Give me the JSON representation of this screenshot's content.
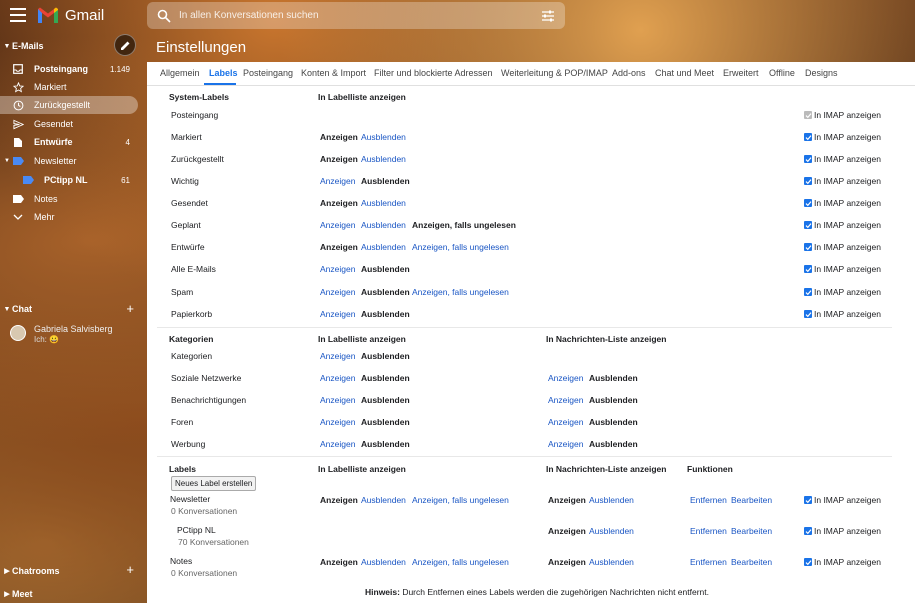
{
  "app": {
    "name": "Gmail"
  },
  "search": {
    "placeholder": "In allen Konversationen suchen"
  },
  "sidebar": {
    "section_mails": "E-Mails",
    "items": [
      {
        "label": "Posteingang",
        "count": "1.149"
      },
      {
        "label": "Markiert",
        "count": ""
      },
      {
        "label": "Zurückgestellt",
        "count": ""
      },
      {
        "label": "Gesendet",
        "count": ""
      },
      {
        "label": "Entwürfe",
        "count": "4"
      },
      {
        "label": "Newsletter",
        "count": ""
      },
      {
        "label": "PCtipp NL",
        "count": "61"
      },
      {
        "label": "Notes",
        "count": ""
      },
      {
        "label": "Mehr",
        "count": ""
      }
    ],
    "section_chat": "Chat",
    "chat_user": {
      "name": "Gabriela Salvisberg",
      "status": "Ich: 😀"
    },
    "section_chatrooms": "Chatrooms",
    "section_meet": "Meet"
  },
  "page_title": "Einstellungen",
  "tabs": [
    "Allgemein",
    "Labels",
    "Posteingang",
    "Konten & Import",
    "Filter und blockierte Adressen",
    "Weiterleitung & POP/IMAP",
    "Add-ons",
    "Chat und Meet",
    "Erweitert",
    "Offline",
    "Designs"
  ],
  "system": {
    "header": "System-Labels",
    "col_list": "In Labelliste anzeigen",
    "rows": [
      {
        "name": "Posteingang",
        "opts": [],
        "imap": "In IMAP anzeigen"
      },
      {
        "name": "Markiert",
        "opts": [
          [
            "Anzeigen",
            true
          ],
          [
            "Ausblenden",
            false
          ]
        ],
        "imap": "In IMAP anzeigen"
      },
      {
        "name": "Zurückgestellt",
        "opts": [
          [
            "Anzeigen",
            true
          ],
          [
            "Ausblenden",
            false
          ]
        ],
        "imap": "In IMAP anzeigen"
      },
      {
        "name": "Wichtig",
        "opts": [
          [
            "Anzeigen",
            false
          ],
          [
            "Ausblenden",
            true
          ]
        ],
        "imap": "In IMAP anzeigen"
      },
      {
        "name": "Gesendet",
        "opts": [
          [
            "Anzeigen",
            true
          ],
          [
            "Ausblenden",
            false
          ]
        ],
        "imap": "In IMAP anzeigen"
      },
      {
        "name": "Geplant",
        "opts": [
          [
            "Anzeigen",
            false
          ],
          [
            "Ausblenden",
            false
          ],
          [
            "Anzeigen, falls ungelesen",
            true
          ]
        ],
        "imap": "In IMAP anzeigen"
      },
      {
        "name": "Entwürfe",
        "opts": [
          [
            "Anzeigen",
            true
          ],
          [
            "Ausblenden",
            false
          ],
          [
            "Anzeigen, falls ungelesen",
            false
          ]
        ],
        "imap": "In IMAP anzeigen"
      },
      {
        "name": "Alle E-Mails",
        "opts": [
          [
            "Anzeigen",
            false
          ],
          [
            "Ausblenden",
            true
          ]
        ],
        "imap": "In IMAP anzeigen"
      },
      {
        "name": "Spam",
        "opts": [
          [
            "Anzeigen",
            false
          ],
          [
            "Ausblenden",
            true
          ],
          [
            "Anzeigen, falls ungelesen",
            false
          ]
        ],
        "imap": "In IMAP anzeigen"
      },
      {
        "name": "Papierkorb",
        "opts": [
          [
            "Anzeigen",
            false
          ],
          [
            "Ausblenden",
            true
          ]
        ],
        "imap": "In IMAP anzeigen"
      }
    ]
  },
  "categories": {
    "header": "Kategorien",
    "col_list": "In Labelliste anzeigen",
    "col_msgs": "In Nachrichten-Liste anzeigen",
    "rows": [
      {
        "name": "Kategorien",
        "list": [
          [
            "Anzeigen",
            false
          ],
          [
            "Ausblenden",
            true
          ]
        ],
        "msgs": []
      },
      {
        "name": "Soziale Netzwerke",
        "list": [
          [
            "Anzeigen",
            false
          ],
          [
            "Ausblenden",
            true
          ]
        ],
        "msgs": [
          [
            "Anzeigen",
            false
          ],
          [
            "Ausblenden",
            true
          ]
        ]
      },
      {
        "name": "Benachrichtigungen",
        "list": [
          [
            "Anzeigen",
            false
          ],
          [
            "Ausblenden",
            true
          ]
        ],
        "msgs": [
          [
            "Anzeigen",
            false
          ],
          [
            "Ausblenden",
            true
          ]
        ]
      },
      {
        "name": "Foren",
        "list": [
          [
            "Anzeigen",
            false
          ],
          [
            "Ausblenden",
            true
          ]
        ],
        "msgs": [
          [
            "Anzeigen",
            false
          ],
          [
            "Ausblenden",
            true
          ]
        ]
      },
      {
        "name": "Werbung",
        "list": [
          [
            "Anzeigen",
            false
          ],
          [
            "Ausblenden",
            true
          ]
        ],
        "msgs": [
          [
            "Anzeigen",
            false
          ],
          [
            "Ausblenden",
            true
          ]
        ]
      }
    ]
  },
  "labels": {
    "header": "Labels",
    "col_list": "In Labelliste anzeigen",
    "col_msgs": "In Nachrichten-Liste anzeigen",
    "col_func": "Funktionen",
    "new_label_button": "Neues Label erstellen",
    "rows": [
      {
        "name": "Newsletter",
        "sub": "0 Konversationen",
        "list": [
          [
            "Anzeigen",
            true
          ],
          [
            "Ausblenden",
            false
          ],
          [
            "Anzeigen, falls ungelesen",
            false
          ]
        ],
        "msgs": [
          [
            "Anzeigen",
            true
          ],
          [
            "Ausblenden",
            false
          ]
        ],
        "remove": "Entfernen",
        "edit": "Bearbeiten",
        "imap": "In IMAP anzeigen"
      },
      {
        "name": "PCtipp NL",
        "sub": "70 Konversationen",
        "list": [],
        "msgs": [
          [
            "Anzeigen",
            true
          ],
          [
            "Ausblenden",
            false
          ]
        ],
        "remove": "Entfernen",
        "edit": "Bearbeiten",
        "imap": "In IMAP anzeigen"
      },
      {
        "name": "Notes",
        "sub": "0 Konversationen",
        "list": [
          [
            "Anzeigen",
            true
          ],
          [
            "Ausblenden",
            false
          ],
          [
            "Anzeigen, falls ungelesen",
            false
          ]
        ],
        "msgs": [
          [
            "Anzeigen",
            true
          ],
          [
            "Ausblenden",
            false
          ]
        ],
        "remove": "Entfernen",
        "edit": "Bearbeiten",
        "imap": "In IMAP anzeigen"
      }
    ],
    "hint_bold": "Hinweis:",
    "hint_text": " Durch Entfernen eines Labels werden die zugehörigen Nachrichten nicht entfernt."
  },
  "colors": {
    "accent": "#1a73e8",
    "link": "#1a56c4"
  }
}
